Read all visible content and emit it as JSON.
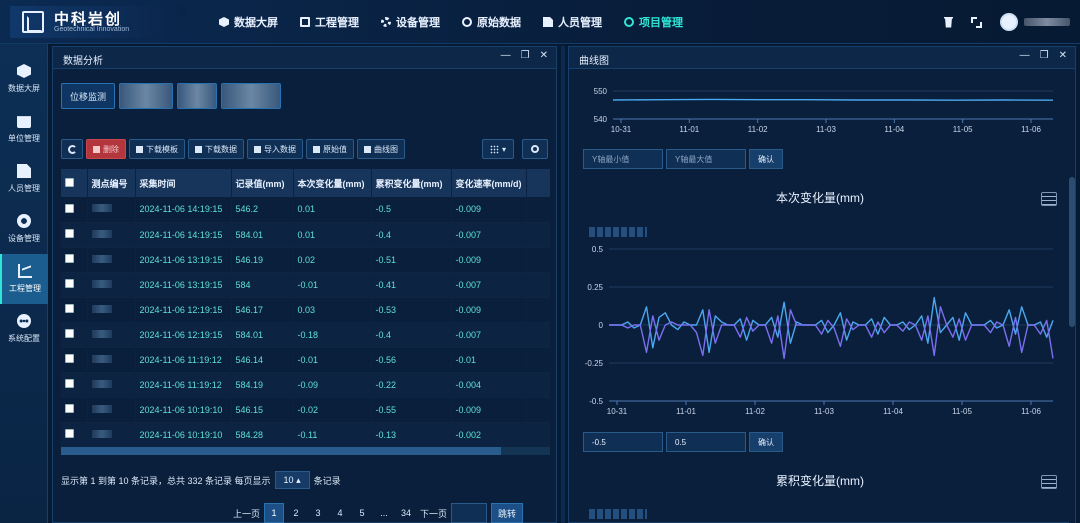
{
  "app": {
    "brand_name": "中科岩创",
    "brand_sub": "Geotechnical Innovation"
  },
  "nav": [
    {
      "label": "数据大屏",
      "icon": "cube-icon"
    },
    {
      "label": "工程管理",
      "icon": "monitor-icon"
    },
    {
      "label": "设备管理",
      "icon": "gear-icon"
    },
    {
      "label": "原始数据",
      "icon": "ring-icon"
    },
    {
      "label": "人员管理",
      "icon": "document-icon"
    },
    {
      "label": "项目管理",
      "icon": "ring-icon",
      "active": true
    }
  ],
  "sidebar": [
    {
      "label": "数据大屏",
      "icon": "cube-icon"
    },
    {
      "label": "单位管理",
      "icon": "calendar-icon"
    },
    {
      "label": "人员管理",
      "icon": "document-icon"
    },
    {
      "label": "设备管理",
      "icon": "gear-icon"
    },
    {
      "label": "工程管理",
      "icon": "chart-icon",
      "active": true
    },
    {
      "label": "系统配置",
      "icon": "more-icon"
    }
  ],
  "left_panel": {
    "title": "数据分析",
    "chip_first": "位移监测",
    "toolbar": {
      "delete": "删除",
      "download_template": "下载模板",
      "download_data": "下载数据",
      "import_data": "导入数据",
      "raw_value": "原始值",
      "curve_chart": "曲线图"
    },
    "table": {
      "headers": [
        "测点编号",
        "采集时间",
        "记录值(mm)",
        "本次变化量(mm)",
        "累积变化量(mm)",
        "变化速率(mm/d)"
      ],
      "rows": [
        [
          "2024-11-06 14:19:15",
          "546.2",
          "0.01",
          "-0.5",
          "-0.009"
        ],
        [
          "2024-11-06 14:19:15",
          "584.01",
          "0.01",
          "-0.4",
          "-0.007"
        ],
        [
          "2024-11-06 13:19:15",
          "546.19",
          "0.02",
          "-0.51",
          "-0.009"
        ],
        [
          "2024-11-06 13:19:15",
          "584",
          "-0.01",
          "-0.41",
          "-0.007"
        ],
        [
          "2024-11-06 12:19:15",
          "546.17",
          "0.03",
          "-0.53",
          "-0.009"
        ],
        [
          "2024-11-06 12:19:15",
          "584.01",
          "-0.18",
          "-0.4",
          "-0.007"
        ],
        [
          "2024-11-06 11:19:12",
          "546.14",
          "-0.01",
          "-0.56",
          "-0.01"
        ],
        [
          "2024-11-06 11:19:12",
          "584.19",
          "-0.09",
          "-0.22",
          "-0.004"
        ],
        [
          "2024-11-06 10:19:10",
          "546.15",
          "-0.02",
          "-0.55",
          "-0.009"
        ],
        [
          "2024-11-06 10:19:10",
          "584.28",
          "-0.11",
          "-0.13",
          "-0.002"
        ]
      ]
    },
    "pager": {
      "info_prefix": "显示第 1 到第 10 条记录，总共 332 条记录 每页显示",
      "page_size": "10",
      "info_suffix": "条记录",
      "prev": "上一页",
      "pages": [
        "1",
        "2",
        "3",
        "4",
        "5",
        "...",
        "34"
      ],
      "active_page": "1",
      "next": "下一页",
      "jump": "跳转"
    }
  },
  "right_panel": {
    "title": "曲线图",
    "ymin_placeholder": "Y轴最小值",
    "ymax_placeholder": "Y轴最大值",
    "confirm": "确认",
    "chart2_min": "-0.5",
    "chart2_max": "0.5",
    "chart3_title": "累积变化量(mm)"
  },
  "colors": {
    "accent": "#2ee6d6",
    "series_primary": "#4aa8f0",
    "series_secondary": "#7a6ff0",
    "danger": "#b3363d"
  },
  "chart_data": [
    {
      "type": "line",
      "title": "",
      "x": [
        "10-31",
        "11-01",
        "11-02",
        "11-03",
        "11-04",
        "11-05",
        "11-06"
      ],
      "yticks": [
        "550",
        "540"
      ],
      "ylim": [
        540,
        555
      ],
      "series": [
        {
          "values": [
            546.8,
            546.9,
            547.0,
            546.9,
            546.9,
            546.8,
            546.8,
            546.7,
            546.8,
            546.7
          ]
        }
      ]
    },
    {
      "type": "line",
      "title": "本次变化量(mm)",
      "x": [
        "10-31",
        "11-01",
        "11-02",
        "11-03",
        "11-04",
        "11-05",
        "11-06"
      ],
      "yticks": [
        "0.5",
        "0.25",
        "0",
        "-0.25",
        "-0.5"
      ],
      "ylim": [
        -0.5,
        0.5
      ],
      "series": [
        {
          "values": [
            0,
            0,
            0,
            0.02,
            -0.02,
            0,
            0.12,
            -0.15,
            0.05,
            0.08,
            0,
            -0.03,
            0.02,
            0,
            0,
            0.1,
            -0.18,
            0.06,
            0.02,
            0,
            0,
            0.04,
            -0.1,
            0.03,
            0,
            0,
            0.05,
            -0.08,
            0.15,
            -0.12,
            0.02,
            0,
            0,
            0,
            0.03,
            -0.05,
            0,
            0.08,
            -0.1,
            0.02,
            0,
            0,
            0.04,
            -0.06,
            0.05,
            0,
            0,
            0.02,
            -0.03,
            0,
            0.06,
            -0.12,
            0.18,
            -0.05,
            0,
            0.05,
            -0.1,
            0.08,
            0,
            0,
            0,
            0.03,
            -0.02,
            0,
            0.1,
            -0.06,
            0.12,
            0,
            0,
            0.02,
            -0.08,
            0.03
          ]
        },
        {
          "values": [
            0,
            0,
            0,
            -0.02,
            0,
            0,
            -0.18,
            0.06,
            -0.1,
            0,
            0.02,
            0,
            0,
            0,
            -0.05,
            -0.2,
            0.1,
            -0.12,
            0,
            0,
            0,
            -0.08,
            0.05,
            -0.04,
            0,
            0,
            -0.12,
            0.06,
            -0.22,
            0.1,
            0,
            0,
            0,
            0,
            -0.06,
            0.03,
            -0.02,
            -0.14,
            0.04,
            -0.03,
            0,
            0,
            -0.08,
            0.02,
            -0.05,
            0,
            0,
            -0.04,
            0.02,
            0,
            -0.1,
            0.06,
            -0.2,
            0.12,
            0,
            -0.08,
            0.04,
            -0.1,
            0,
            0,
            0,
            -0.05,
            0.02,
            0,
            -0.14,
            0.05,
            -0.18,
            0,
            0,
            -0.06,
            0.03,
            -0.22
          ]
        }
      ]
    }
  ]
}
